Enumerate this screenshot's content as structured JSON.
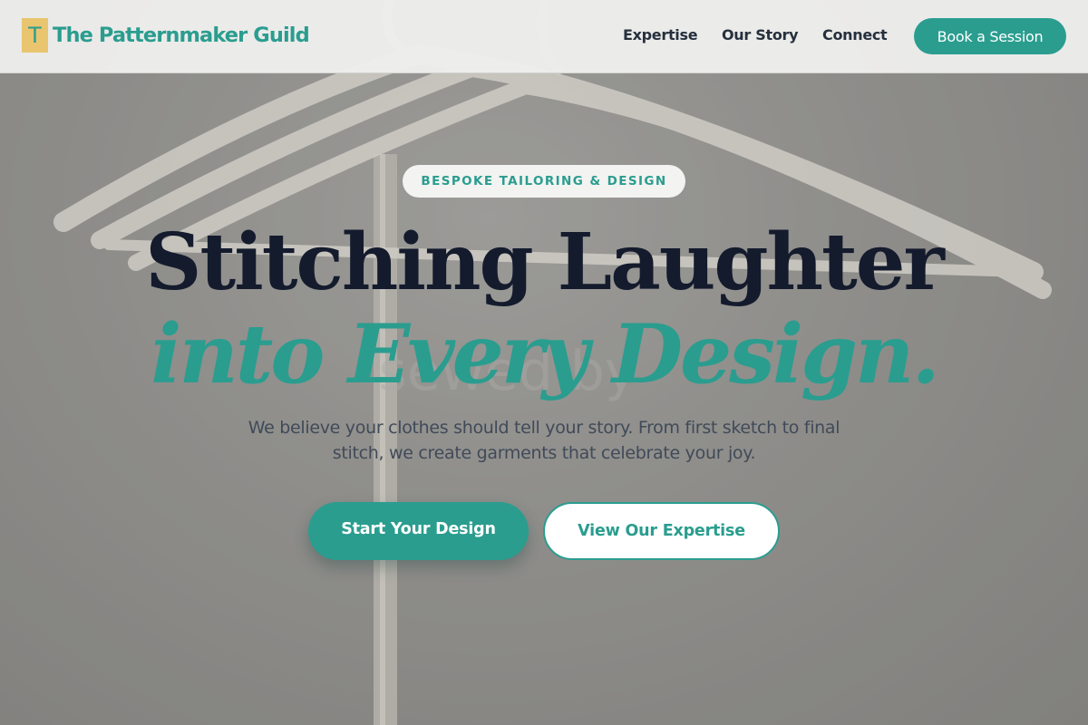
{
  "header": {
    "logo_mark": "T",
    "brand": "The Patternmaker Guild",
    "nav": [
      "Expertise",
      "Our Story",
      "Connect"
    ],
    "cta": "Book a Session"
  },
  "hero": {
    "badge": "BESPOKE TAILORING & DESIGN",
    "title_line1": "Stitching Laughter",
    "title_line2": "into Every Design.",
    "lede": "We believe your clothes should tell your story. From first sketch to final stitch, we create garments that celebrate your joy.",
    "primary_cta": "Start Your Design",
    "secondary_cta": "View Our Expertise"
  },
  "colors": {
    "accent": "#2a9d8f",
    "logo_badge": "#e8c56e",
    "heading": "#141b2d"
  }
}
